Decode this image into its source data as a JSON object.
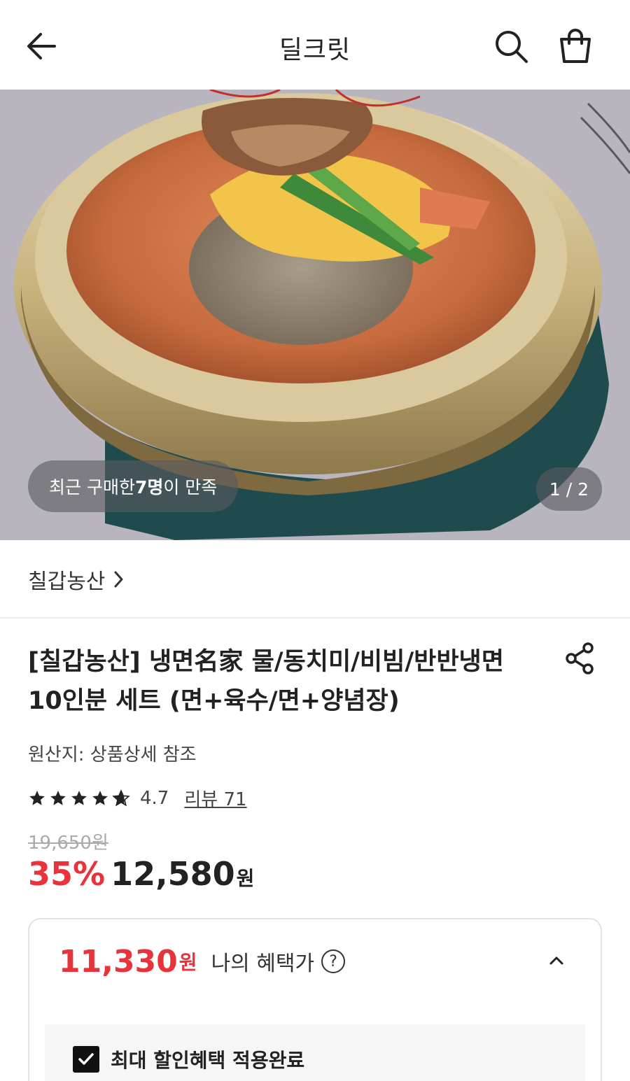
{
  "header": {
    "title": "딜크릿"
  },
  "hero": {
    "purchase_prefix": "최근 구매한 ",
    "purchase_count": "7명",
    "purchase_suffix": "이 만족",
    "pager": "1 / 2"
  },
  "seller": {
    "name": "칠갑농산"
  },
  "product": {
    "title": "[칠갑농산] 냉면名家 물/동치미/비빔/반반냉면 10인분 세트 (면+육수/면+양념장)",
    "origin": "원산지: 상품상세 참조",
    "rating": 4.7,
    "rating_text": "4.7",
    "review_label": "리뷰 71",
    "original_price": "19,650원",
    "discount": "35%",
    "price": "12,580",
    "currency": "원"
  },
  "benefit": {
    "price": "11,330",
    "currency": "원",
    "label": "나의 혜택가",
    "help_symbol": "?",
    "applied_label": "최대 할인혜택 적용완료"
  },
  "colors": {
    "accent_red": "#e8333a",
    "text_dark": "#222222",
    "muted": "#aaaaaa"
  },
  "icons": [
    "back-arrow-icon",
    "search-icon",
    "shopping-bag-icon",
    "chevron-right-icon",
    "share-icon",
    "star-icon",
    "question-circle-icon",
    "chevron-up-icon",
    "checkmark-icon"
  ]
}
